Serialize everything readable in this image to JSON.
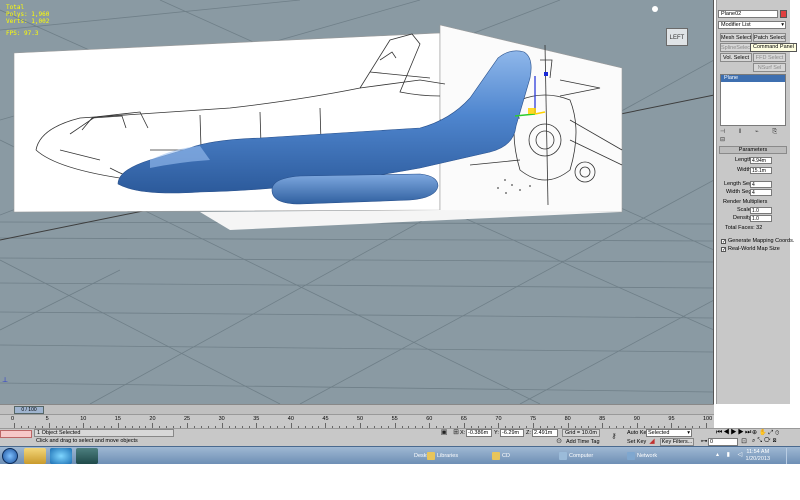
{
  "viewport": {
    "stats": [
      "Total",
      "Polys: 1,960",
      "Verts: 1,002",
      "FPS: 97.3"
    ],
    "viewcube_label": "LEFT"
  },
  "command_panel": {
    "object_name": "Plane02",
    "modifier_list": "Modifier List",
    "buttons": {
      "mesh_select": "Mesh Select",
      "patch_select": "Patch Select",
      "spline_select": "SplineSelect",
      "poly_select": "Poly Select",
      "vol_select": "Vol. Select",
      "fff_select": "FFD Select",
      "nsurf_sel": "NSurf Sel"
    },
    "tooltip": "Command Panel",
    "stack_item": "Plane",
    "rollout_title": "Parameters",
    "params": {
      "length_label": "Length:",
      "length_value": "4.94m",
      "width_label": "Width:",
      "width_value": "15.1m",
      "length_segs_label": "Length Segs:",
      "length_segs_value": "4",
      "width_segs_label": "Width Segs:",
      "width_segs_value": "4",
      "render_mult_label": "Render Multipliers",
      "scale_label": "Scale:",
      "scale_value": "1.0",
      "density_label": "Density:",
      "density_value": "1.0",
      "total_faces": "Total Faces: 32",
      "gen_mapping": "Generate Mapping Coords.",
      "real_world": "Real-World Map Size"
    }
  },
  "timeline": {
    "slider_label": "0 / 100",
    "ticks": [
      "0",
      "5",
      "10",
      "15",
      "20",
      "25",
      "30",
      "35",
      "40",
      "45",
      "50",
      "55",
      "60",
      "65",
      "70",
      "75",
      "80",
      "85",
      "90",
      "95",
      "100"
    ]
  },
  "status": {
    "selection": "1 Object Selected",
    "prompt": "Click and drag to select and move objects",
    "x_label": "X:",
    "x_value": "-0.386m",
    "y_label": "Y:",
    "y_value": "-6.29m",
    "z_label": "Z:",
    "z_value": "2.491m",
    "grid": "Grid = 10.0m",
    "add_time_tag": "Add Time Tag",
    "auto_key": "Auto Key",
    "set_key": "Set Key",
    "key_mode": "Selected",
    "key_filters": "Key Filters...",
    "frame": "0"
  },
  "taskbar": {
    "items": [
      "Desktop",
      "Libraries",
      "CD",
      "Computer",
      "Network"
    ],
    "time": "11:54 AM",
    "date": "1/20/2013"
  },
  "colors": {
    "viewport_bg": "#8a9aa3",
    "model_blue": "#4f86cf",
    "stat_yellow": "#ffff00"
  }
}
